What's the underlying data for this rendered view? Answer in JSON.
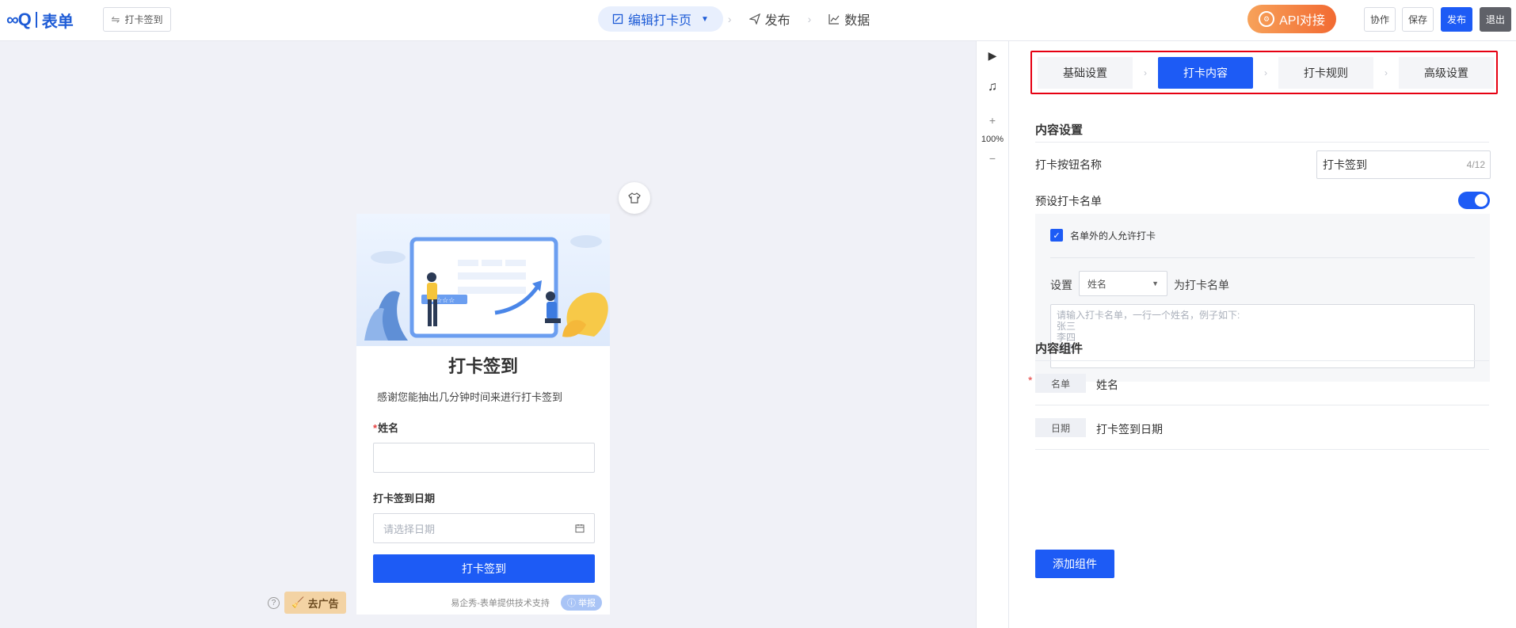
{
  "brand": {
    "logo_mark": "∞Q",
    "logo_text": "表单"
  },
  "header": {
    "form_name": "打卡签到",
    "steps": [
      {
        "label": "编辑打卡页",
        "icon": "edit-icon",
        "active": true
      },
      {
        "label": "发布",
        "icon": "send-icon",
        "active": false
      },
      {
        "label": "数据",
        "icon": "chart-icon",
        "active": false
      }
    ],
    "api_label": "API对接",
    "collab_label": "协作",
    "save_label": "保存",
    "publish_label": "发布",
    "exit_label": "退出"
  },
  "tools": {
    "zoom_in": "+",
    "zoom_level": "100%",
    "zoom_out": "−"
  },
  "preview": {
    "title": "打卡签到",
    "description": "感谢您能抽出几分钟时间来进行打卡签到",
    "field_name_label": "姓名",
    "field_date_label": "打卡签到日期",
    "date_placeholder": "请选择日期",
    "submit_label": "打卡签到",
    "footer_text": "易企秀-表单提供技术支持",
    "report_label": "举报"
  },
  "ad": {
    "label": "去广告",
    "help": "?"
  },
  "panel": {
    "tabs": [
      "基础设置",
      "打卡内容",
      "打卡规则",
      "高级设置"
    ],
    "active_tab": 1,
    "content_settings_title": "内容设置",
    "button_name_label": "打卡按钮名称",
    "button_name_value": "打卡签到",
    "button_name_count": "4/12",
    "preset_list_label": "预设打卡名单",
    "preset_enabled": true,
    "allow_outside_label": "名单外的人允许打卡",
    "allow_outside_checked": true,
    "set_label": "设置",
    "set_select_value": "姓名",
    "as_list_label": "为打卡名单",
    "namelist_placeholder": "请输入打卡名单，一行一个姓名，例子如下:\n张三\n李四\n王五",
    "components_title": "内容组件",
    "components": [
      {
        "tag": "名单",
        "name": "姓名",
        "required": true
      },
      {
        "tag": "日期",
        "name": "打卡签到日期",
        "required": false
      }
    ],
    "add_component_label": "添加组件"
  },
  "colors": {
    "primary": "#1d5bf5",
    "highlight_frame": "#e60012",
    "api_gradient_start": "#f7a25a",
    "api_gradient_end": "#f26a32"
  }
}
